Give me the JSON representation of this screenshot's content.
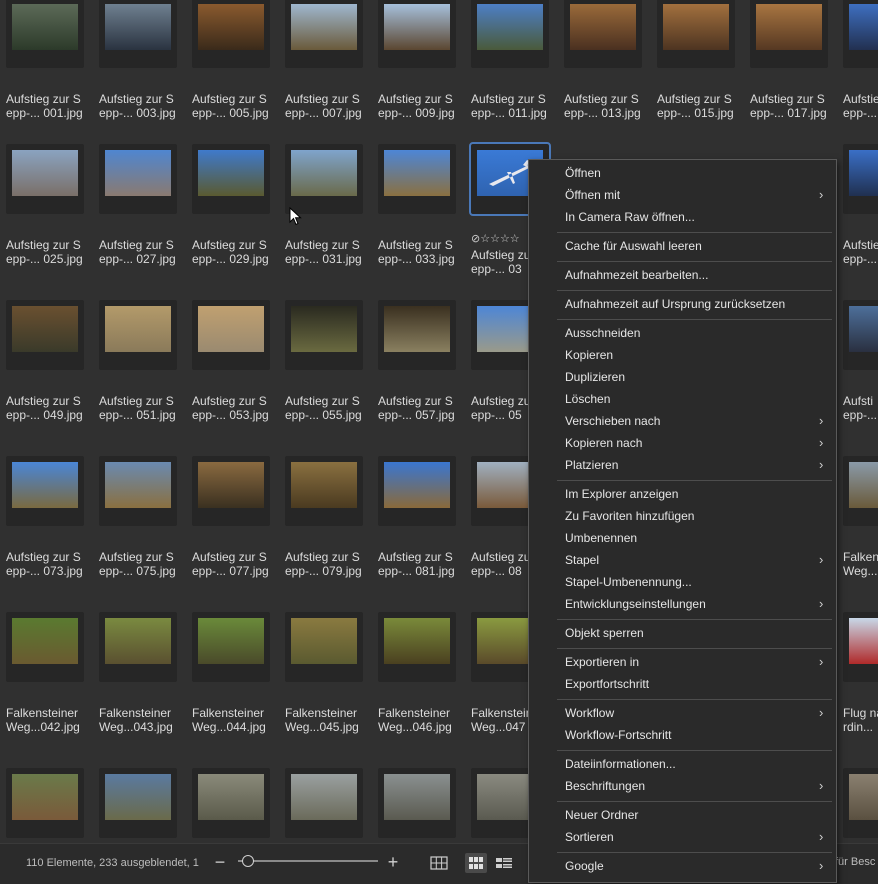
{
  "grid": {
    "rows": [
      {
        "items": [
          {
            "line1": "Aufstieg zur S",
            "line2": "epp-... 001.jpg",
            "colors": [
              "#5c6a58",
              "#2c3a2a"
            ]
          },
          {
            "line1": "Aufstieg zur S",
            "line2": "epp-... 003.jpg",
            "colors": [
              "#6f8090",
              "#2a3340"
            ]
          },
          {
            "line1": "Aufstieg zur S",
            "line2": "epp-... 005.jpg",
            "colors": [
              "#8a5a2e",
              "#3a2a1a"
            ]
          },
          {
            "line1": "Aufstieg zur S",
            "line2": "epp-... 007.jpg",
            "colors": [
              "#9fb7cf",
              "#6a5a3a"
            ]
          },
          {
            "line1": "Aufstieg zur S",
            "line2": "epp-... 009.jpg",
            "colors": [
              "#a6c0dc",
              "#5b4630"
            ]
          },
          {
            "line1": "Aufstieg zur S",
            "line2": "epp-... 011.jpg",
            "colors": [
              "#4d7fc6",
              "#4a5a3a"
            ]
          },
          {
            "line1": "Aufstieg zur S",
            "line2": "epp-... 013.jpg",
            "colors": [
              "#9a6a3a",
              "#4a3020"
            ]
          },
          {
            "line1": "Aufstieg zur S",
            "line2": "epp-... 015.jpg",
            "colors": [
              "#a2703e",
              "#4d3421"
            ]
          },
          {
            "line1": "Aufstieg zur S",
            "line2": "epp-... 017.jpg",
            "colors": [
              "#a87541",
              "#553822"
            ]
          },
          {
            "line1": "Aufstieg zur S",
            "line2": "epp-...",
            "colors": [
              "#3e6fc0",
              "#223050"
            ]
          }
        ]
      },
      {
        "items": [
          {
            "line1": "Aufstieg zur S",
            "line2": "epp-... 025.jpg",
            "colors": [
              "#8aa3c0",
              "#7a6f68"
            ]
          },
          {
            "line1": "Aufstieg zur S",
            "line2": "epp-... 027.jpg",
            "colors": [
              "#4f86d0",
              "#8a7a70"
            ]
          },
          {
            "line1": "Aufstieg zur S",
            "line2": "epp-... 029.jpg",
            "colors": [
              "#3f7acb",
              "#5a5a30"
            ]
          },
          {
            "line1": "Aufstieg zur S",
            "line2": "epp-... 031.jpg",
            "colors": [
              "#7fa4cc",
              "#6a6a4a"
            ]
          },
          {
            "line1": "Aufstieg zur S",
            "line2": "epp-... 033.jpg",
            "colors": [
              "#4d86d6",
              "#8a7040"
            ]
          },
          {
            "line1": "Aufstieg zur S",
            "line2": "epp-... 03",
            "colors": [
              "#3a7ad6",
              "#2f63b0"
            ],
            "selected": true
          },
          {
            "line1": "",
            "line2": "",
            "colors": [
              "#303030",
              "#303030"
            ]
          },
          {
            "line1": "",
            "line2": "",
            "colors": [
              "#303030",
              "#303030"
            ]
          },
          {
            "line1": "",
            "line2": "",
            "colors": [
              "#303030",
              "#303030"
            ]
          },
          {
            "line1": "Aufstie",
            "line2": "epp-...",
            "colors": [
              "#3a6fc6",
              "#203050"
            ]
          }
        ]
      },
      {
        "items": [
          {
            "line1": "Aufstieg zur S",
            "line2": "epp-... 049.jpg",
            "colors": [
              "#6a5030",
              "#3a3a2a"
            ]
          },
          {
            "line1": "Aufstieg zur S",
            "line2": "epp-... 051.jpg",
            "colors": [
              "#b39a6a",
              "#8a7a5a"
            ]
          },
          {
            "line1": "Aufstieg zur S",
            "line2": "epp-... 053.jpg",
            "colors": [
              "#c0a070",
              "#9a8a70"
            ]
          },
          {
            "line1": "Aufstieg zur S",
            "line2": "epp-... 055.jpg",
            "colors": [
              "#2a2a20",
              "#6a6a40"
            ]
          },
          {
            "line1": "Aufstieg zur S",
            "line2": "epp-... 057.jpg",
            "colors": [
              "#3a3020",
              "#8a8060"
            ]
          },
          {
            "line1": "Aufstieg zu",
            "line2": "epp-... 05",
            "colors": [
              "#4d86d6",
              "#9a9a8a"
            ]
          },
          {
            "line1": "",
            "line2": "",
            "colors": [
              "#303030",
              "#303030"
            ]
          },
          {
            "line1": "",
            "line2": "",
            "colors": [
              "#303030",
              "#303030"
            ]
          },
          {
            "line1": "",
            "line2": "",
            "colors": [
              "#303030",
              "#303030"
            ]
          },
          {
            "line1": "Aufsti",
            "line2": "epp-...",
            "colors": [
              "#4d6f9a",
              "#2a3040"
            ]
          }
        ]
      },
      {
        "items": [
          {
            "line1": "Aufstieg zur S",
            "line2": "epp-... 073.jpg",
            "colors": [
              "#4a86d6",
              "#7a6a40"
            ]
          },
          {
            "line1": "Aufstieg zur S",
            "line2": "epp-... 075.jpg",
            "colors": [
              "#6a8ab0",
              "#8a7040"
            ]
          },
          {
            "line1": "Aufstieg zur S",
            "line2": "epp-... 077.jpg",
            "colors": [
              "#8a6a40",
              "#3a3020"
            ]
          },
          {
            "line1": "Aufstieg zur S",
            "line2": "epp-... 079.jpg",
            "colors": [
              "#8a7040",
              "#4a3a20"
            ]
          },
          {
            "line1": "Aufstieg zur S",
            "line2": "epp-... 081.jpg",
            "colors": [
              "#3a76d0",
              "#8a6a3a"
            ]
          },
          {
            "line1": "Aufstieg zu",
            "line2": "epp-... 08",
            "colors": [
              "#a0b0c0",
              "#7a5a3a"
            ]
          },
          {
            "line1": "",
            "line2": "",
            "colors": [
              "#303030",
              "#303030"
            ]
          },
          {
            "line1": "",
            "line2": "",
            "colors": [
              "#303030",
              "#303030"
            ]
          },
          {
            "line1": "",
            "line2": "",
            "colors": [
              "#303030",
              "#303030"
            ]
          },
          {
            "line1": "Falkens",
            "line2": "Weg...",
            "colors": [
              "#8a9aa8",
              "#6a5a3a"
            ]
          }
        ]
      },
      {
        "items": [
          {
            "line1": "Falkensteiner",
            "line2": "Weg...042.jpg",
            "colors": [
              "#5a7a30",
              "#6a5a30"
            ]
          },
          {
            "line1": "Falkensteiner",
            "line2": "Weg...043.jpg",
            "colors": [
              "#7a8a40",
              "#5a5030"
            ]
          },
          {
            "line1": "Falkensteiner",
            "line2": "Weg...044.jpg",
            "colors": [
              "#6a8a3a",
              "#4a4a2a"
            ]
          },
          {
            "line1": "Falkensteiner",
            "line2": "Weg...045.jpg",
            "colors": [
              "#8a7a40",
              "#5a5a30"
            ]
          },
          {
            "line1": "Falkensteiner",
            "line2": "Weg...046.jpg",
            "colors": [
              "#7a8a3a",
              "#4a4020"
            ]
          },
          {
            "line1": "Falkensteiner",
            "line2": "Weg...047",
            "colors": [
              "#8a9a40",
              "#5a4a2a"
            ]
          },
          {
            "line1": "",
            "line2": "",
            "colors": [
              "#303030",
              "#303030"
            ]
          },
          {
            "line1": "",
            "line2": "",
            "colors": [
              "#303030",
              "#303030"
            ]
          },
          {
            "line1": "",
            "line2": "",
            "colors": [
              "#303030",
              "#303030"
            ]
          },
          {
            "line1": "Flug na",
            "line2": "rdin...",
            "colors": [
              "#c8d8e8",
              "#b02a2a"
            ]
          }
        ]
      },
      {
        "items": [
          {
            "line1": "",
            "line2": "",
            "colors": [
              "#6a7a4a",
              "#7a5a3a"
            ]
          },
          {
            "line1": "",
            "line2": "",
            "colors": [
              "#5a7aa0",
              "#6a6a4a"
            ]
          },
          {
            "line1": "",
            "line2": "",
            "colors": [
              "#8a8a7a",
              "#5a5a4a"
            ]
          },
          {
            "line1": "",
            "line2": "",
            "colors": [
              "#9aa0a0",
              "#6a6a5a"
            ]
          },
          {
            "line1": "",
            "line2": "",
            "colors": [
              "#8a9090",
              "#5a5a50"
            ]
          },
          {
            "line1": "",
            "line2": "",
            "colors": [
              "#8a8a80",
              "#5a5a50"
            ]
          },
          {
            "line1": "",
            "line2": "",
            "colors": [
              "#303030",
              "#303030"
            ]
          },
          {
            "line1": "",
            "line2": "",
            "colors": [
              "#303030",
              "#303030"
            ]
          },
          {
            "line1": "",
            "line2": "",
            "colors": [
              "#303030",
              "#303030"
            ]
          },
          {
            "line1": "",
            "line2": "",
            "colors": [
              "#8a8070",
              "#5a5040"
            ]
          }
        ]
      }
    ]
  },
  "statusbar": {
    "status": "110 Elemente, 233 ausgeblendet, 1",
    "zoom_out": "−",
    "zoom_in": "+",
    "right_text": "für Besc"
  },
  "context_menu": {
    "items": [
      {
        "label": "Öffnen",
        "submenu": false
      },
      {
        "label": "Öffnen mit",
        "submenu": true
      },
      {
        "label": "In Camera Raw öffnen...",
        "submenu": false
      },
      {
        "separator": true
      },
      {
        "label": "Cache für Auswahl leeren",
        "submenu": false
      },
      {
        "separator": true
      },
      {
        "label": "Aufnahmezeit bearbeiten...",
        "submenu": false
      },
      {
        "separator": true
      },
      {
        "label": "Aufnahmezeit auf Ursprung zurücksetzen",
        "submenu": false
      },
      {
        "separator": true
      },
      {
        "label": "Ausschneiden",
        "submenu": false
      },
      {
        "label": "Kopieren",
        "submenu": false
      },
      {
        "label": "Duplizieren",
        "submenu": false
      },
      {
        "label": "Löschen",
        "submenu": false
      },
      {
        "label": "Verschieben nach",
        "submenu": true
      },
      {
        "label": "Kopieren nach",
        "submenu": true
      },
      {
        "label": "Platzieren",
        "submenu": true
      },
      {
        "separator": true
      },
      {
        "label": "Im Explorer anzeigen",
        "submenu": false
      },
      {
        "label": "Zu Favoriten hinzufügen",
        "submenu": false
      },
      {
        "label": "Umbenennen",
        "submenu": false
      },
      {
        "label": "Stapel",
        "submenu": true
      },
      {
        "label": "Stapel-Umbenennung...",
        "submenu": false
      },
      {
        "label": "Entwicklungseinstellungen",
        "submenu": true
      },
      {
        "separator": true
      },
      {
        "label": "Objekt sperren",
        "submenu": false
      },
      {
        "separator": true
      },
      {
        "label": "Exportieren in",
        "submenu": true
      },
      {
        "label": "Exportfortschritt",
        "submenu": false
      },
      {
        "separator": true
      },
      {
        "label": "Workflow",
        "submenu": true
      },
      {
        "label": "Workflow-Fortschritt",
        "submenu": false
      },
      {
        "separator": true
      },
      {
        "label": "Dateiinformationen...",
        "submenu": false
      },
      {
        "label": "Beschriftungen",
        "submenu": true
      },
      {
        "separator": true
      },
      {
        "label": "Neuer Ordner",
        "submenu": false
      },
      {
        "label": "Sortieren",
        "submenu": true
      },
      {
        "separator": true
      },
      {
        "label": "Google",
        "submenu": true
      }
    ]
  },
  "selected_rating": {
    "reject_icon": "reject-circle-icon",
    "stars": "☆☆☆☆"
  }
}
